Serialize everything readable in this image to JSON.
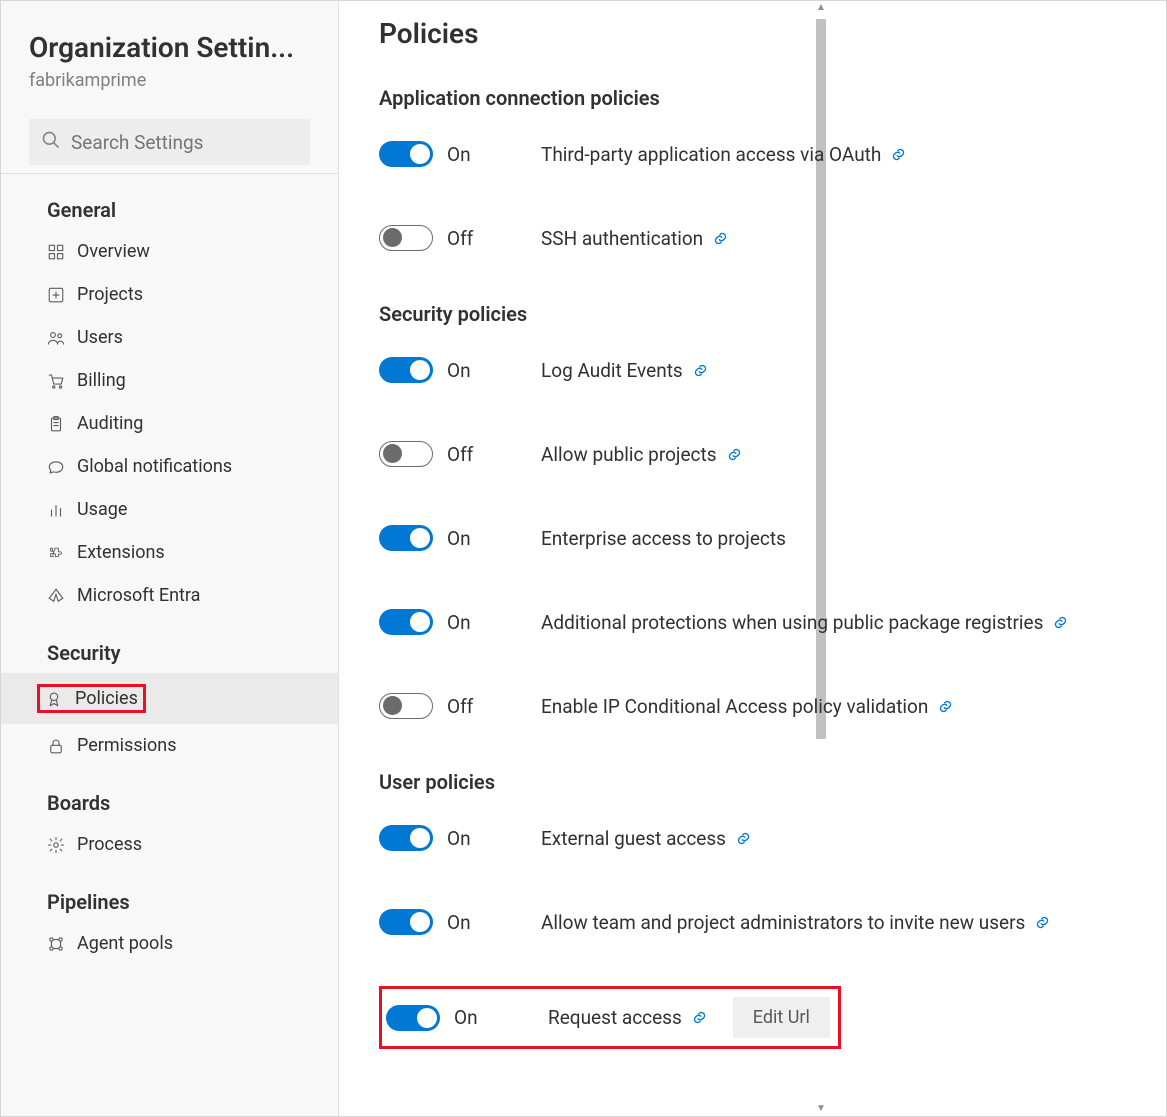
{
  "sidebar": {
    "title": "Organization Settin...",
    "org": "fabrikamprime",
    "search_placeholder": "Search Settings",
    "groups": [
      {
        "title": "General",
        "items": [
          {
            "icon": "grid",
            "label": "Overview"
          },
          {
            "icon": "plus-box",
            "label": "Projects"
          },
          {
            "icon": "users",
            "label": "Users"
          },
          {
            "icon": "cart",
            "label": "Billing"
          },
          {
            "icon": "clipboard",
            "label": "Auditing"
          },
          {
            "icon": "chat",
            "label": "Global notifications"
          },
          {
            "icon": "bar-chart",
            "label": "Usage"
          },
          {
            "icon": "puzzle",
            "label": "Extensions"
          },
          {
            "icon": "entra",
            "label": "Microsoft Entra"
          }
        ]
      },
      {
        "title": "Security",
        "items": [
          {
            "icon": "ribbon",
            "label": "Policies",
            "selected": true,
            "highlighted": true
          },
          {
            "icon": "lock",
            "label": "Permissions"
          }
        ]
      },
      {
        "title": "Boards",
        "items": [
          {
            "icon": "gear",
            "label": "Process"
          }
        ]
      },
      {
        "title": "Pipelines",
        "items": [
          {
            "icon": "pool",
            "label": "Agent pools"
          }
        ]
      }
    ]
  },
  "main": {
    "page_title": "Policies",
    "sections": [
      {
        "title": "Application connection policies",
        "policies": [
          {
            "on": true,
            "state": "On",
            "label": "Third-party application access via OAuth",
            "link": true
          },
          {
            "on": false,
            "state": "Off",
            "label": "SSH authentication",
            "link": true
          }
        ]
      },
      {
        "title": "Security policies",
        "policies": [
          {
            "on": true,
            "state": "On",
            "label": "Log Audit Events",
            "link": true
          },
          {
            "on": false,
            "state": "Off",
            "label": "Allow public projects",
            "link": true
          },
          {
            "on": true,
            "state": "On",
            "label": "Enterprise access to projects",
            "link": false
          },
          {
            "on": true,
            "state": "On",
            "label": "Additional protections when using public package registries",
            "link": true
          },
          {
            "on": false,
            "state": "Off",
            "label": "Enable IP Conditional Access policy validation",
            "link": true
          }
        ]
      },
      {
        "title": "User policies",
        "policies": [
          {
            "on": true,
            "state": "On",
            "label": "External guest access",
            "link": true
          },
          {
            "on": true,
            "state": "On",
            "label": "Allow team and project administrators to invite new users",
            "link": true
          },
          {
            "on": true,
            "state": "On",
            "label": "Request access",
            "link": true,
            "edit_url": "Edit Url",
            "highlighted": true
          }
        ]
      }
    ]
  }
}
